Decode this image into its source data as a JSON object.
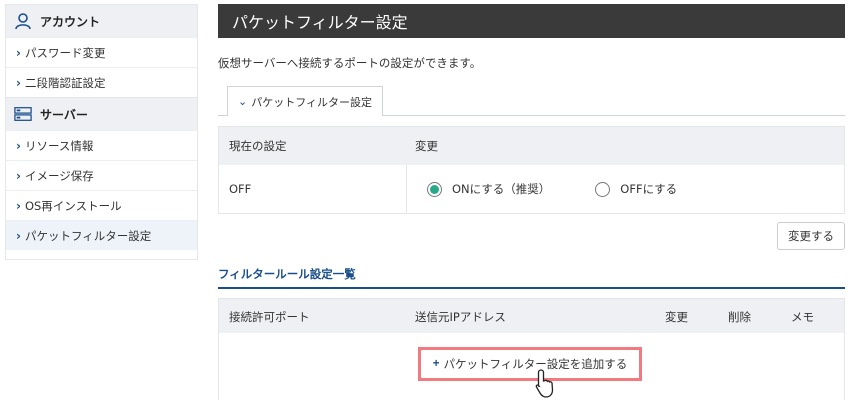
{
  "sidebar": {
    "account": {
      "title": "アカウント",
      "icon": "user-icon"
    },
    "account_items": [
      {
        "label": "パスワード変更"
      },
      {
        "label": "二段階認証設定"
      }
    ],
    "server": {
      "title": "サーバー",
      "icon": "server-icon"
    },
    "server_items": [
      {
        "label": "リソース情報"
      },
      {
        "label": "イメージ保存"
      },
      {
        "label": "OS再インストール"
      },
      {
        "label": "パケットフィルター設定",
        "active": true
      }
    ]
  },
  "main": {
    "title": "パケットフィルター設定",
    "description": "仮想サーバーへ接続するポートの設定ができます。",
    "tab_label": "パケットフィルター設定",
    "settings": {
      "col_current": "現在の設定",
      "col_change": "変更",
      "current_value": "OFF",
      "option_on": "ONにする（推奨）",
      "option_off": "OFFにする",
      "selected": "on"
    },
    "change_button": "変更する",
    "rules": {
      "section_title": "フィルタールール設定一覧",
      "columns": [
        "接続許可ポート",
        "送信元IPアドレス",
        "変更",
        "削除",
        "メモ"
      ],
      "add_button": "パケットフィルター設定を追加する"
    }
  },
  "colors": {
    "accent": "#1a4f8b",
    "radio_selected": "#2aa88a",
    "highlight_border": "#f07a7f",
    "title_bar": "#3a3a3a"
  }
}
